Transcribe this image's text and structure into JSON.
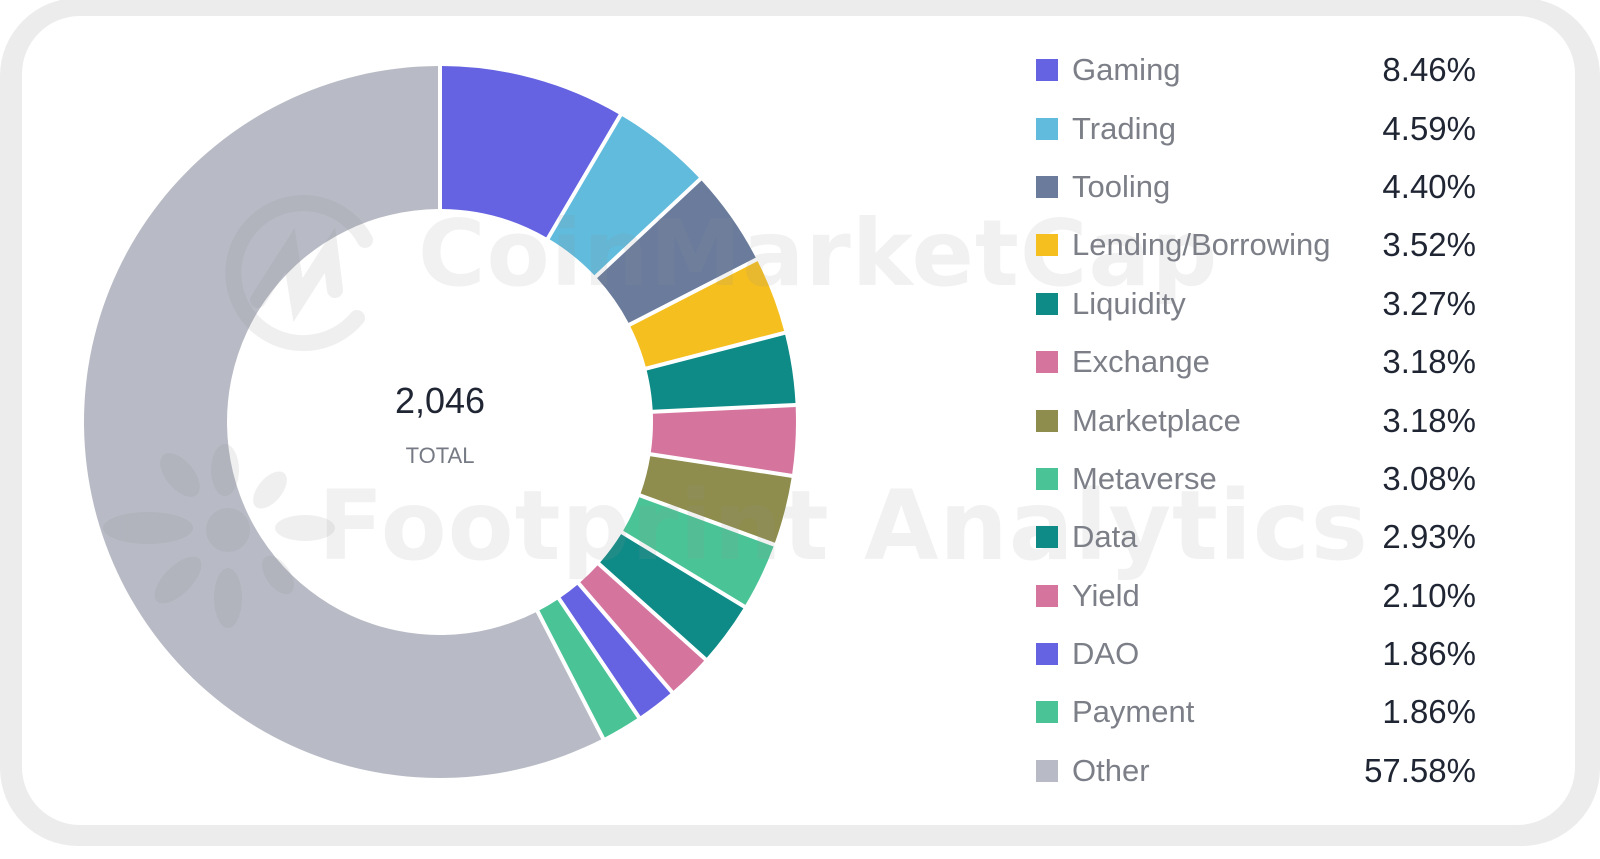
{
  "chart_data": {
    "type": "pie",
    "variant": "donut",
    "title": "",
    "center": {
      "value": "2,046",
      "label": "TOTAL"
    },
    "start": "top",
    "direction": "clockwise",
    "legend_position": "right",
    "slices": [
      {
        "label": "Gaming",
        "value": 8.46,
        "display": "8.46%",
        "color": "#6563e1"
      },
      {
        "label": "Trading",
        "value": 4.59,
        "display": "4.59%",
        "color": "#60bbdd"
      },
      {
        "label": "Tooling",
        "value": 4.4,
        "display": "4.40%",
        "color": "#6a7b9c"
      },
      {
        "label": "Lending/Borrowing",
        "value": 3.52,
        "display": "3.52%",
        "color": "#f5bf1f"
      },
      {
        "label": "Liquidity",
        "value": 3.27,
        "display": "3.27%",
        "color": "#0e8b87"
      },
      {
        "label": "Exchange",
        "value": 3.18,
        "display": "3.18%",
        "color": "#d5759e"
      },
      {
        "label": "Marketplace",
        "value": 3.18,
        "display": "3.18%",
        "color": "#8e8d4e"
      },
      {
        "label": "Metaverse",
        "value": 3.08,
        "display": "3.08%",
        "color": "#4ac497"
      },
      {
        "label": "Data",
        "value": 2.93,
        "display": "2.93%",
        "color": "#0e8b87"
      },
      {
        "label": "Yield",
        "value": 2.1,
        "display": "2.10%",
        "color": "#d5759e"
      },
      {
        "label": "DAO",
        "value": 1.86,
        "display": "1.86%",
        "color": "#6563e1"
      },
      {
        "label": "Payment",
        "value": 1.86,
        "display": "1.86%",
        "color": "#4ac497"
      },
      {
        "label": "Other",
        "value": 57.58,
        "display": "57.58%",
        "color": "#b8bbc5"
      }
    ]
  },
  "watermarks": {
    "top": "CoinMarketCap",
    "bottom": "Footprint Analytics"
  }
}
